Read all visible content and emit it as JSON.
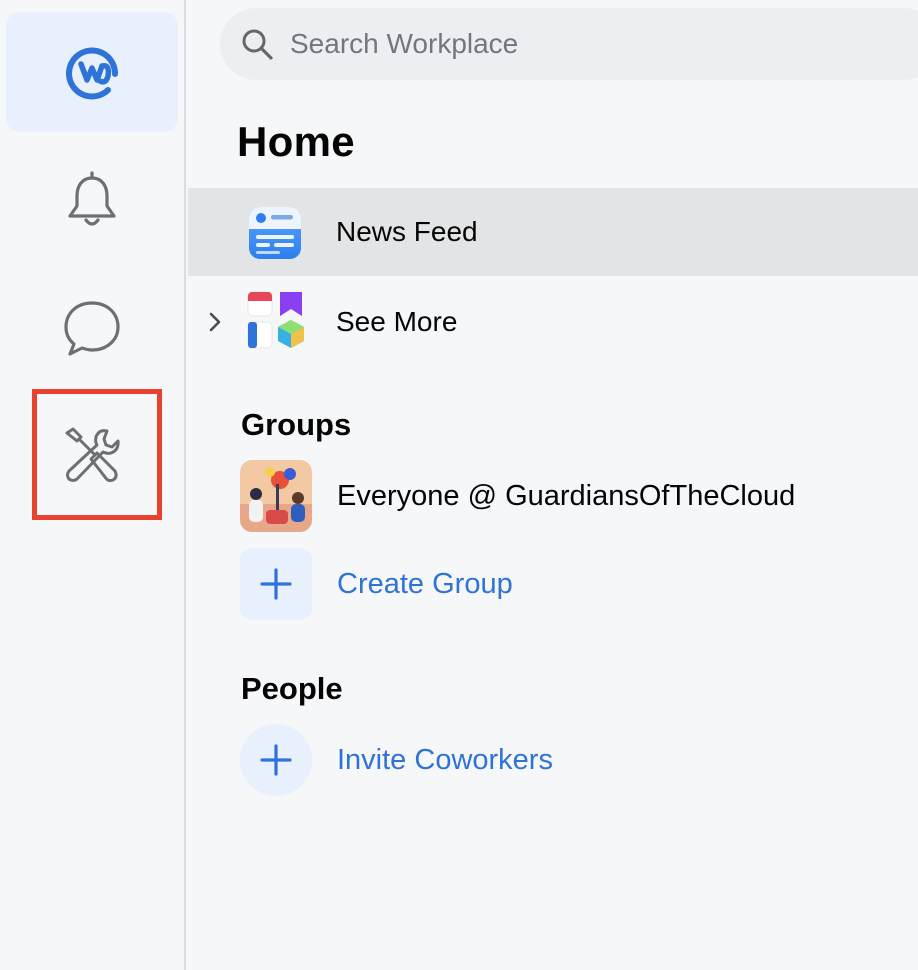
{
  "rail": {
    "items": [
      {
        "name": "home",
        "icon": "workplace-logo-icon",
        "active": true
      },
      {
        "name": "notifications",
        "icon": "bell-icon",
        "active": false
      },
      {
        "name": "chats",
        "icon": "chat-bubble-icon",
        "active": false
      },
      {
        "name": "admin-tools",
        "icon": "tools-icon",
        "active": false,
        "highlighted": true
      }
    ]
  },
  "search": {
    "placeholder": "Search Workplace"
  },
  "main": {
    "title": "Home",
    "nav": [
      {
        "label": "News Feed",
        "icon": "news-feed-icon",
        "selected": true
      },
      {
        "label": "See More",
        "icon": "apps-grid-icon",
        "expandable": true
      }
    ],
    "groups": {
      "title": "Groups",
      "items": [
        {
          "label": "Everyone @ GuardiansOfTheCloud",
          "icon": "group-cover-image"
        },
        {
          "label": "Create Group",
          "icon": "plus-icon",
          "action": true
        }
      ]
    },
    "people": {
      "title": "People",
      "items": [
        {
          "label": "Invite Coworkers",
          "icon": "plus-icon",
          "action": true
        }
      ]
    }
  },
  "colors": {
    "accent": "#2f73d8",
    "active_bg": "#e7f0fc",
    "selected_row_bg": "#e3e4e6",
    "highlight_outline": "#e8422e"
  }
}
